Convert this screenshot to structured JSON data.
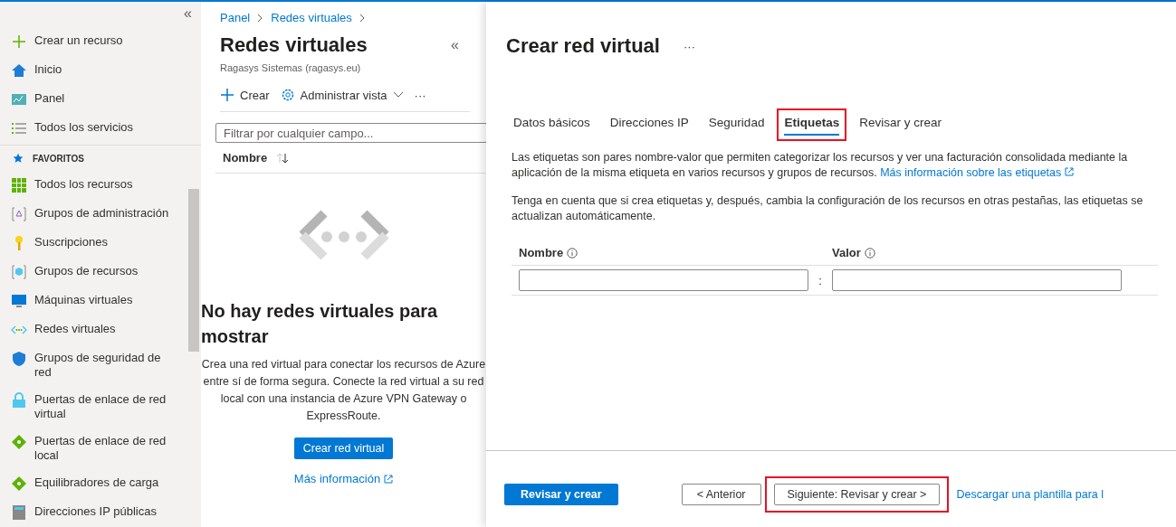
{
  "sidebar": {
    "collapse": "«",
    "items": [
      {
        "kind": "item",
        "label": "Crear un recurso"
      },
      {
        "kind": "item",
        "label": "Inicio"
      },
      {
        "kind": "item",
        "label": "Panel"
      },
      {
        "kind": "item",
        "label": "Todos los servicios"
      },
      {
        "kind": "section",
        "label": "FAVORITOS"
      },
      {
        "kind": "item",
        "label": "Todos los recursos"
      },
      {
        "kind": "item",
        "label": "Grupos de administración"
      },
      {
        "kind": "item",
        "label": "Suscripciones"
      },
      {
        "kind": "item",
        "label": "Grupos de recursos"
      },
      {
        "kind": "item",
        "label": "Máquinas virtuales"
      },
      {
        "kind": "item",
        "label": "Redes virtuales"
      },
      {
        "kind": "item",
        "label": "Grupos de seguridad de red"
      },
      {
        "kind": "item",
        "label": "Puertas de enlace de red virtual"
      },
      {
        "kind": "item",
        "label": "Puertas de enlace de red local"
      },
      {
        "kind": "item",
        "label": "Equilibradores de carga"
      },
      {
        "kind": "item",
        "label": "Direcciones IP públicas"
      }
    ]
  },
  "list_panel": {
    "breadcrumb": [
      "Panel",
      "Redes virtuales"
    ],
    "title": "Redes virtuales",
    "subtitle": "Ragasys Sistemas (ragasys.eu)",
    "collapse": "«",
    "toolbar": {
      "create": "Crear",
      "manage": "Administrar vista",
      "more": "···"
    },
    "filter": {
      "placeholder": "Filtrar por cualquier campo..."
    },
    "column": "Nombre",
    "empty": {
      "title": "No hay redes virtuales para mostrar",
      "text": "Crea una red virtual para conectar los recursos de Azure entre sí de forma segura. Conecte la red virtual a su red local con una instancia de Azure VPN Gateway o ExpressRoute.",
      "button": "Crear red virtual",
      "link": "Más información"
    }
  },
  "create_panel": {
    "title": "Crear red virtual",
    "more": "···",
    "tabs": [
      {
        "label": "Datos básicos",
        "selected": false,
        "highlighted": false
      },
      {
        "label": "Direcciones IP",
        "selected": false,
        "highlighted": false
      },
      {
        "label": "Seguridad",
        "selected": false,
        "highlighted": false
      },
      {
        "label": "Etiquetas",
        "selected": true,
        "highlighted": true
      },
      {
        "label": "Revisar y crear",
        "selected": false,
        "highlighted": false
      }
    ],
    "intro": "Las etiquetas son pares nombre-valor que permiten categorizar los recursos y ver una facturación consolidada mediante la aplicación de la misma etiqueta en varios recursos y grupos de recursos.",
    "intro_link": "Más información sobre las etiquetas",
    "note": "Tenga en cuenta que si crea etiquetas y, después, cambia la configuración de los recursos en otras pestañas, las etiquetas se actualizan automáticamente.",
    "columns": [
      "Nombre",
      "Valor"
    ],
    "separator": ":",
    "footer": {
      "primary": "Revisar y crear",
      "previous": "< Anterior",
      "next": {
        "label": "Siguiente: Revisar y crear >",
        "highlighted": true
      },
      "link": "Descargar una plantilla para l"
    }
  }
}
